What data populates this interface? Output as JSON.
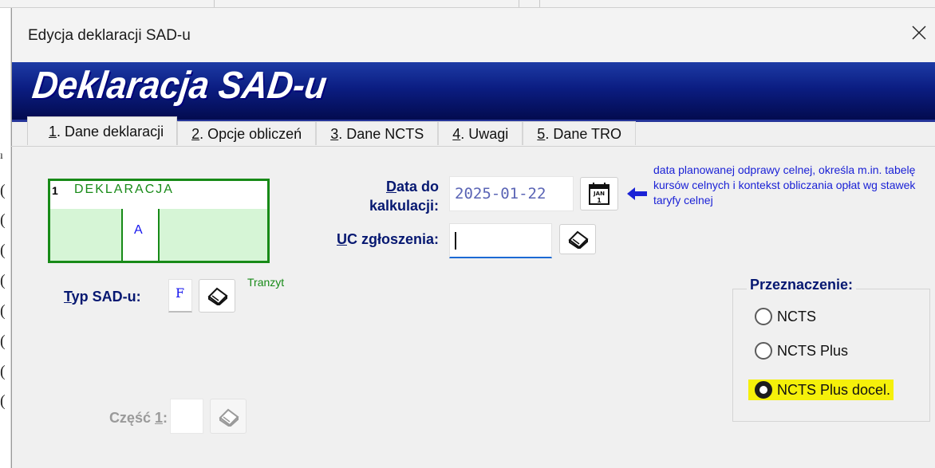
{
  "window": {
    "title": "Edycja deklaracji SAD-u",
    "close_icon": "close-icon"
  },
  "banner": {
    "title": "Deklaracja SAD-u"
  },
  "tabs": [
    {
      "key": "1",
      "label": ". Dane deklaracji",
      "active": true
    },
    {
      "key": "2",
      "label": ". Opcje obliczeń",
      "active": false
    },
    {
      "key": "3",
      "label": ". Dane NCTS",
      "active": false
    },
    {
      "key": "4",
      "label": ". Uwagi",
      "active": false
    },
    {
      "key": "5",
      "label": ". Dane TRO",
      "active": false
    }
  ],
  "declaration_box": {
    "number": "1",
    "label": "DEKLARACJA",
    "cell_value": "A"
  },
  "date_field": {
    "label_key": "D",
    "label_rest": "ata do",
    "label_line2": "kalkulacji:",
    "value": "2025-01-22",
    "calendar_icon_text": "JAN\n1"
  },
  "hint_text": "data planowanej odprawy celnej, określa m.in. tabelę kursów celnych i kontekst obliczania opłat wg stawek taryfy celnej",
  "uc_field": {
    "label_key": "U",
    "label_rest": "C zgłoszenia:",
    "value": ""
  },
  "typ_sad": {
    "label_key": "T",
    "label_rest": "yp SAD-u:",
    "value": "F",
    "description": "Tranzyt"
  },
  "czesc": {
    "label_before": "Część ",
    "label_key": "1",
    "label_after": ":",
    "value": ""
  },
  "przeznaczenie": {
    "title": "Przeznaczenie:",
    "options": [
      {
        "label": "NCTS",
        "checked": false
      },
      {
        "label": "NCTS Plus",
        "checked": false
      },
      {
        "label": "NCTS Plus docel.",
        "checked": true
      }
    ]
  },
  "colors": {
    "banner": "#0b1d82",
    "label_text": "#061871",
    "declaration_green": "#178a17",
    "hint_blue": "#1b22d6",
    "highlight": "#f5f00a"
  },
  "background_window": {
    "left_edge_glyphs": [
      "ı",
      "(",
      "(",
      "(",
      "(",
      "(",
      "(",
      "(",
      "("
    ]
  }
}
